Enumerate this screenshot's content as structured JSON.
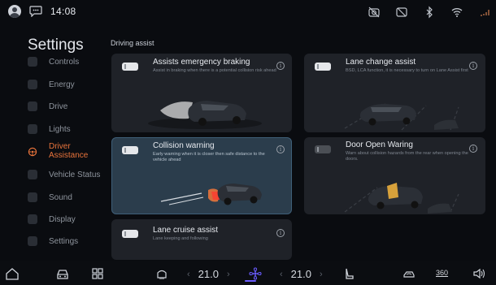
{
  "status": {
    "time": "14:08"
  },
  "page": {
    "title": "Settings",
    "section_label": "Driving assist"
  },
  "sidebar": {
    "items": [
      {
        "label": "Controls"
      },
      {
        "label": "Energy"
      },
      {
        "label": "Drive"
      },
      {
        "label": "Lights"
      },
      {
        "label": "Driver\nAssistance",
        "active": true
      },
      {
        "label": "Vehicle Status"
      },
      {
        "label": "Sound"
      },
      {
        "label": "Display"
      },
      {
        "label": "Settings"
      }
    ]
  },
  "cards": {
    "emergency_braking": {
      "title": "Assists emergency braking",
      "desc": "Assist in braking when there is a potential collision risk ahead",
      "enabled": true
    },
    "lane_change": {
      "title": "Lane change assist",
      "desc": "BSD, LCA function, it is necessary to turn on Lane Assist first",
      "enabled": true
    },
    "collision_warning": {
      "title": "Collision warning",
      "desc": "Early warning when it is closer then safe distance to the vehicle ahead",
      "enabled": true
    },
    "door_open": {
      "title": "Door Open Waring",
      "desc": "Warn about collision hazards from the rear when opening the doors.",
      "enabled": false
    },
    "lane_cruise": {
      "title": "Lane cruise assist",
      "desc": "Lane keeping and following",
      "enabled": true
    }
  },
  "climate": {
    "left_temp": "21.0",
    "right_temp": "21.0",
    "rotate_label": "360"
  },
  "colors": {
    "accent": "#e8733b",
    "selected_card": "#2b3d4c",
    "fan_active": "#6a5cff"
  }
}
